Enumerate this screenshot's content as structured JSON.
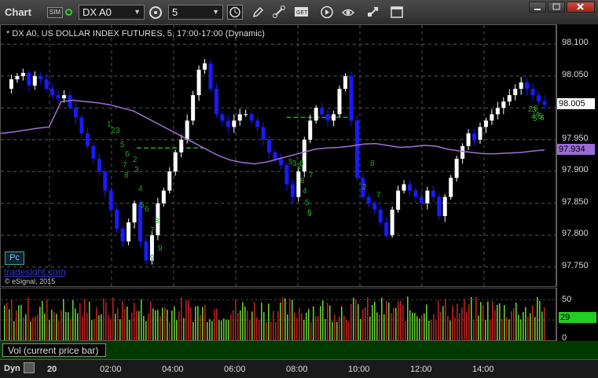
{
  "toolbar": {
    "title": "Chart",
    "sim_badge": "SIM",
    "symbol": "DX A0",
    "interval": "5",
    "icons": [
      "timer-icon",
      "clock-icon",
      "pencil-icon",
      "link-icon",
      "get-icon",
      "play-icon",
      "eye-icon",
      "move-icon",
      "window-icon"
    ]
  },
  "window_buttons": [
    "minimize",
    "maximize",
    "close"
  ],
  "chart": {
    "title": "* DX A0, US DOLLAR INDEX FUTURES, 5, 17:00-17:00 (Dynamic)",
    "watermark": "tradesight.com",
    "copyright": "© eSignal, 2015",
    "pc_badge": "Pc",
    "colors": {
      "up": "#ffffff",
      "down": "#1a1aff",
      "ma": "#a070d8",
      "level": "#22aa22",
      "count": "#22aa22"
    },
    "price_labels": [
      "98.100",
      "98.050",
      "98.000",
      "97.950",
      "97.900",
      "97.850",
      "97.800",
      "97.750"
    ],
    "last_price": "98.005",
    "ma_price": "97.934",
    "counts": [
      "1",
      "2",
      "3",
      "5",
      "6",
      "7",
      "8",
      "2",
      "3",
      "4",
      "5",
      "6",
      "7",
      "8",
      "9",
      "5",
      "3",
      "2",
      "8",
      "4",
      "5",
      "6",
      "7",
      "2",
      "6",
      "9",
      "7",
      "8",
      "9",
      "2",
      "3",
      "4",
      "5",
      "6",
      "6",
      "4",
      "5",
      "6"
    ]
  },
  "chart_data": {
    "type": "candlestick",
    "ylim": [
      97.72,
      98.13
    ],
    "x_ticks": [
      "20",
      "02:00",
      "04:00",
      "06:00",
      "08:00",
      "10:00",
      "12:00",
      "14:00"
    ],
    "close_path": [
      98.03,
      98.045,
      98.05,
      98.055,
      98.035,
      98.05,
      98.045,
      98.03,
      98.02,
      98.015,
      98.02,
      98.0,
      97.985,
      97.96,
      97.94,
      97.92,
      97.9,
      97.87,
      97.84,
      97.81,
      97.79,
      97.82,
      97.85,
      97.79,
      97.76,
      97.8,
      97.85,
      97.87,
      97.9,
      97.93,
      97.95,
      97.98,
      98.02,
      98.06,
      98.07,
      98.03,
      97.99,
      97.98,
      97.97,
      97.98,
      97.99,
      97.99,
      97.98,
      97.97,
      97.95,
      97.93,
      97.92,
      97.91,
      97.88,
      97.86,
      97.9,
      97.95,
      97.98,
      98.0,
      97.99,
      97.98,
      97.99,
      98.03,
      98.05,
      97.98,
      97.89,
      97.86,
      97.85,
      97.84,
      97.82,
      97.8,
      97.84,
      97.87,
      97.88,
      97.87,
      97.86,
      97.85,
      97.87,
      97.86,
      97.83,
      97.86,
      97.89,
      97.92,
      97.94,
      97.96,
      97.95,
      97.97,
      97.98,
      97.99,
      98.0,
      98.01,
      98.02,
      98.03,
      98.04,
      98.03,
      98.02,
      98.01,
      98.005
    ],
    "ma_path": [
      97.96,
      97.962,
      97.965,
      97.968,
      97.97,
      98.01,
      98.012,
      98.01,
      98.008,
      98.005,
      98.0,
      97.995,
      97.985,
      97.975,
      97.965,
      97.955,
      97.945,
      97.935,
      97.925,
      97.918,
      97.914,
      97.912,
      97.915,
      97.92,
      97.925,
      97.93,
      97.935,
      97.937,
      97.938,
      97.94,
      97.943,
      97.944,
      97.941,
      97.938,
      97.939,
      97.941,
      97.94,
      97.935,
      97.932,
      97.93,
      97.928,
      97.928,
      97.929,
      97.93,
      97.932,
      97.934
    ],
    "levels": [
      {
        "price": 97.937,
        "from": 0.245,
        "to": 0.37
      },
      {
        "price": 97.985,
        "from": 0.515,
        "to": 0.63
      }
    ],
    "volume": {
      "ylim": [
        0,
        60
      ],
      "ticks": [
        "50",
        "25",
        "0"
      ],
      "last": "29"
    }
  },
  "volume_panel": {
    "label": "Vol (current price bar)"
  },
  "time_axis": {
    "dyn_label": "Dyn"
  }
}
